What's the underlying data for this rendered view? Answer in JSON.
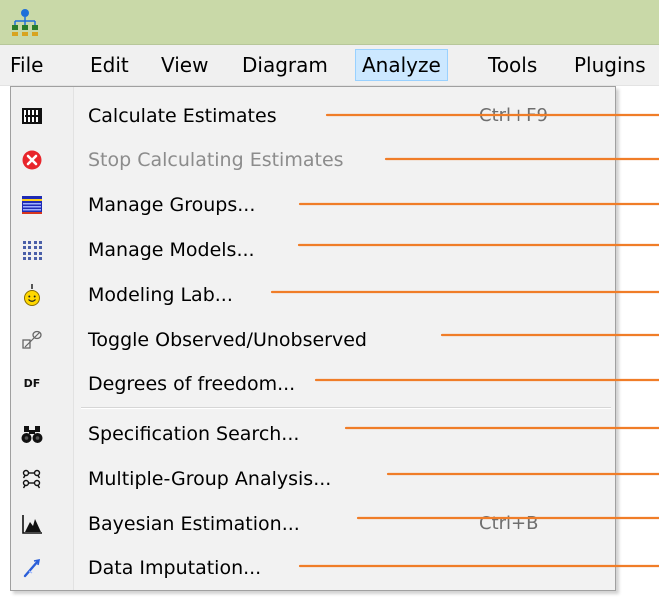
{
  "titlebar": {
    "icon": "amos-path-diagram-icon",
    "color": "#c9d9a8"
  },
  "menubar": {
    "items": [
      {
        "label": "File"
      },
      {
        "label": "Edit"
      },
      {
        "label": "View"
      },
      {
        "label": "Diagram"
      },
      {
        "label": "Analyze"
      },
      {
        "label": "Tools"
      },
      {
        "label": "Plugins"
      }
    ],
    "active": "Analyze"
  },
  "analyze_menu": {
    "items": [
      {
        "label": "Calculate Estimates",
        "shortcut": "Ctrl+F9",
        "icon": "calculate-estimates-icon",
        "enabled": true
      },
      {
        "label": "Stop Calculating Estimates",
        "shortcut": "",
        "icon": "stop-red-x-icon",
        "enabled": false
      },
      {
        "label": "Manage Groups...",
        "shortcut": "",
        "icon": "manage-groups-icon",
        "enabled": true
      },
      {
        "label": "Manage Models...",
        "shortcut": "",
        "icon": "manage-models-icon",
        "enabled": true
      },
      {
        "label": "Modeling Lab...",
        "shortcut": "",
        "icon": "smiley-face-icon",
        "enabled": true
      },
      {
        "label": "Toggle Observed/Unobserved",
        "shortcut": "",
        "icon": "toggle-observed-icon",
        "enabled": true
      },
      {
        "label": "Degrees of freedom...",
        "shortcut": "",
        "icon": "df-icon",
        "enabled": true
      },
      {
        "label": "Specification Search...",
        "shortcut": "",
        "icon": "binoculars-icon",
        "enabled": true
      },
      {
        "label": "Multiple-Group Analysis...",
        "shortcut": "",
        "icon": "multiple-group-icon",
        "enabled": true
      },
      {
        "label": "Bayesian Estimation...",
        "shortcut": "Ctrl+B",
        "icon": "bayesian-distribution-icon",
        "enabled": true
      },
      {
        "label": "Data Imputation...",
        "shortcut": "",
        "icon": "data-imputation-icon",
        "enabled": true
      }
    ],
    "df_icon_text": "DF"
  },
  "colors": {
    "callout_line": "#f07d28",
    "menu_highlight": "#cce8ff",
    "disabled_text": "#8c8c8c"
  }
}
